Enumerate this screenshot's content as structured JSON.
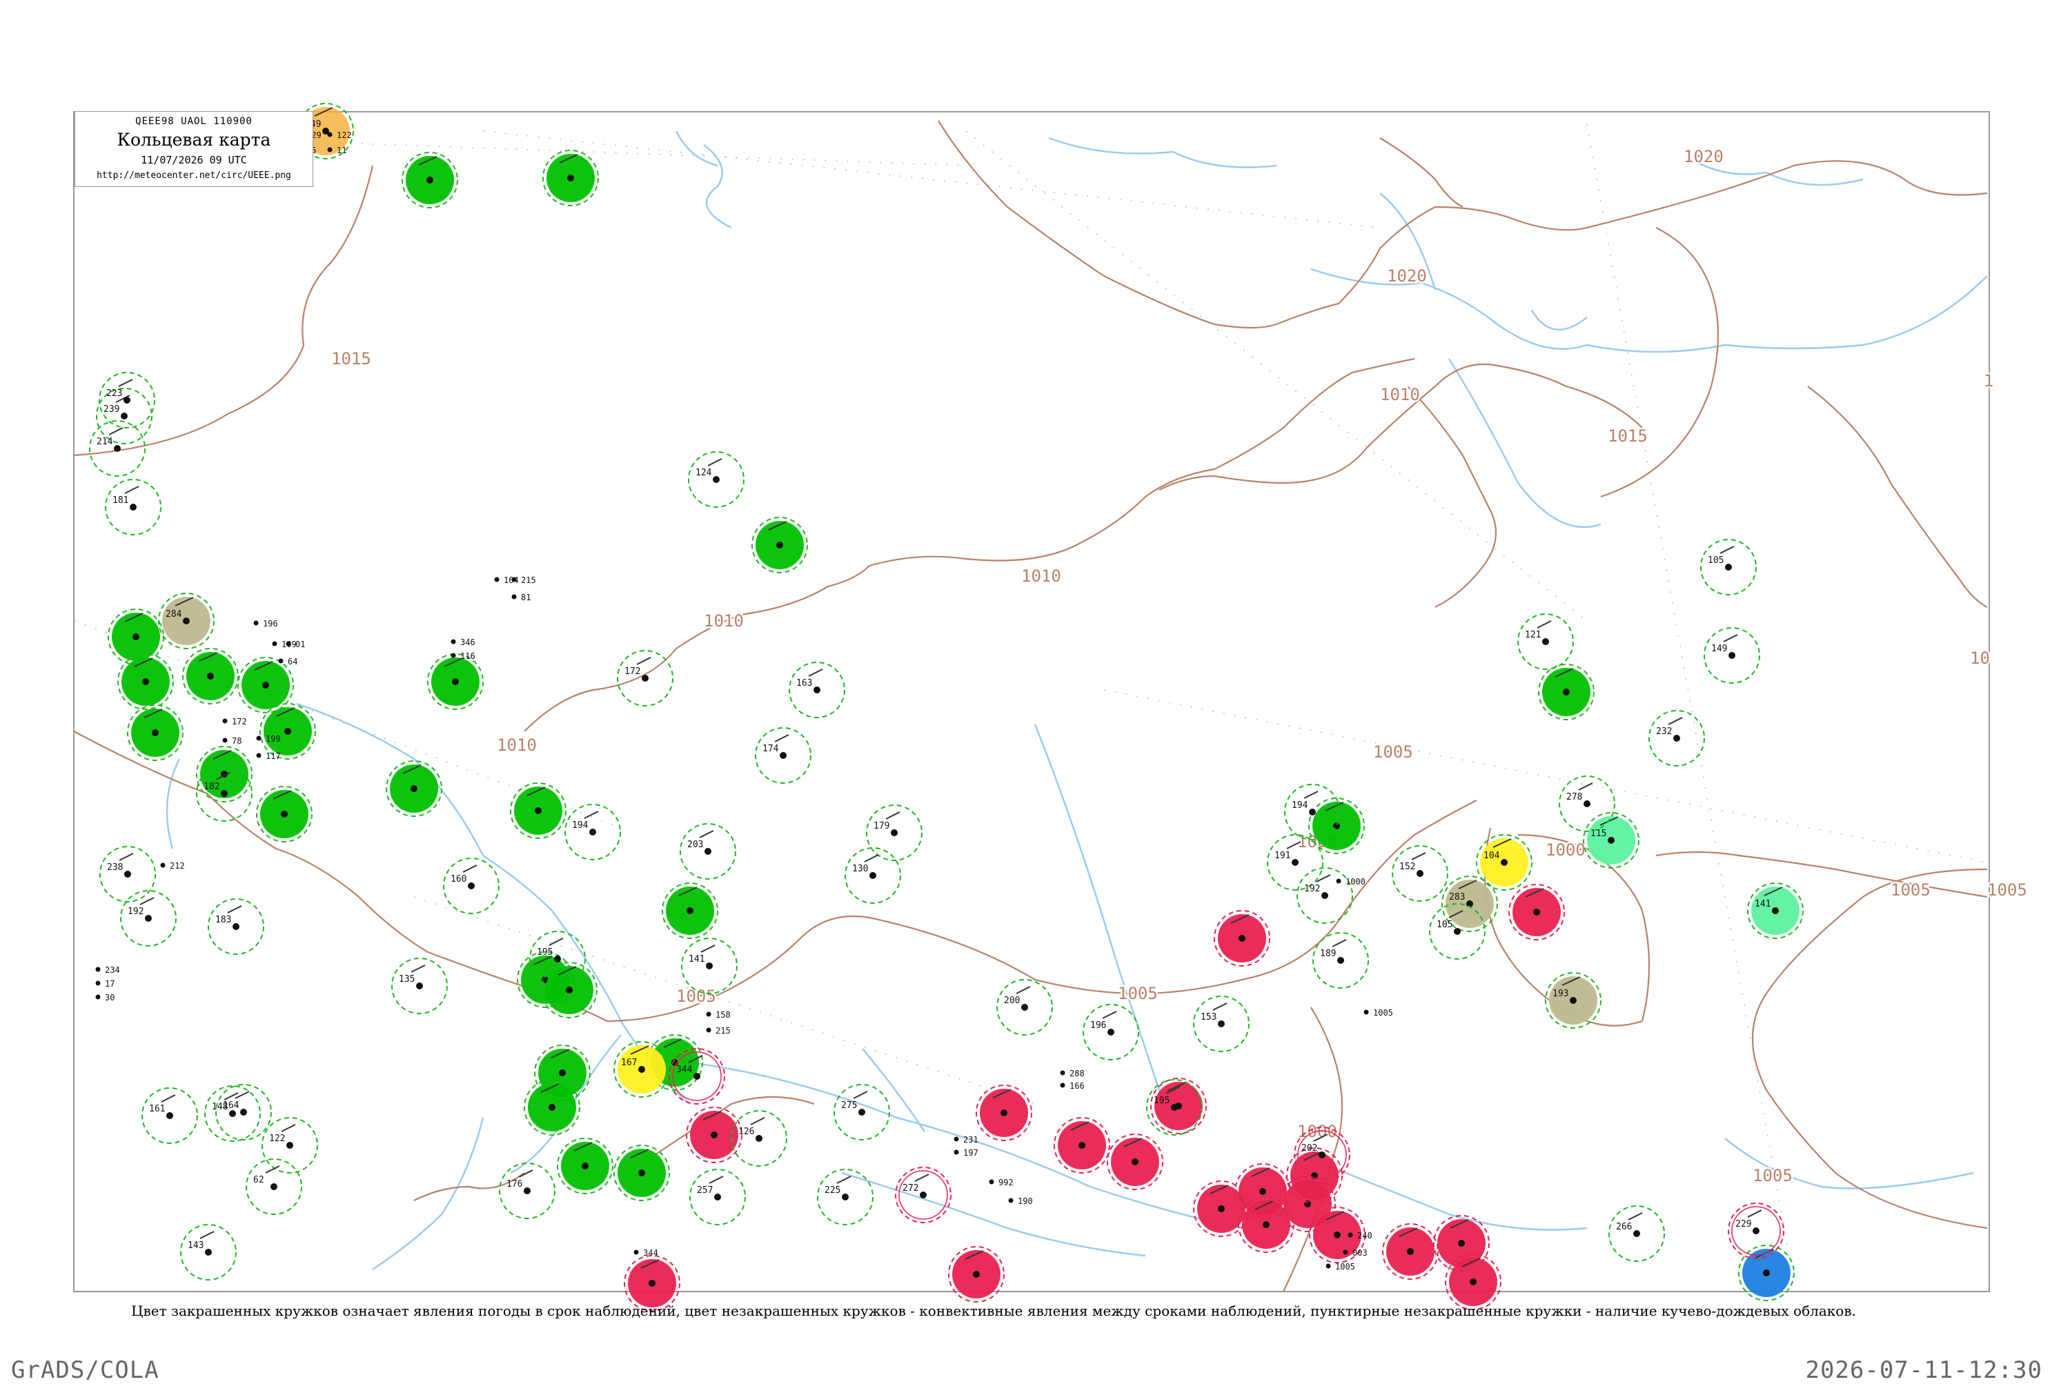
{
  "header": {
    "code": "QEEE98  UAOL  110900",
    "title": "Кольцевая карта",
    "date": "11/07/2026 09 UTC",
    "url": "http://meteocenter.net/circ/UEEE.png"
  },
  "caption": "Цвет закрашенных кружков означает явления погоды в срок наблюдений, цвет незакрашенных кружков - конвективные явления между сроками наблюдений, пунктирные незакрашенные кружки - наличие кучево-дождевых облаков.",
  "footer": {
    "software": "GrADS/COLA",
    "timestamp": "2026-07-11-12:30"
  },
  "colors": {
    "frame": "#999999",
    "isobar": "#b9826a",
    "river": "#9ccbf0",
    "green": "#00c000",
    "red": "#e8224f",
    "olive": "#bdb98f",
    "yellow": "#fff020",
    "orange": "#f7b13f",
    "blue": "#1e7fe0",
    "mint": "#5cf2a0",
    "dash": "#1fb81f",
    "dashRed": "#e8224f"
  },
  "isobar_labels": [
    "1015",
    "1010",
    "1010",
    "1010",
    "1005",
    "1005",
    "1005",
    "1000",
    "1000",
    "1005",
    "1010",
    "1015",
    "1020",
    "1020",
    "1000",
    "1005",
    "1005",
    "10",
    "1"
  ],
  "station_values": [
    "158",
    "110",
    "229",
    "75",
    "122",
    "11",
    "215",
    "81",
    "164",
    "346",
    "116",
    "158",
    "215",
    "196",
    "64",
    "109",
    "01",
    "172",
    "78",
    "199",
    "117",
    "212",
    "234",
    "17",
    "30",
    "1005",
    "1000",
    "288",
    "166",
    "231",
    "197",
    "992",
    "190",
    "344",
    "003",
    "240",
    "1005"
  ],
  "stations": [
    {
      "kind": "filled",
      "color": "orange",
      "value": "149"
    },
    {
      "kind": "filled",
      "color": "green"
    },
    {
      "kind": "filled",
      "color": "green"
    },
    {
      "kind": "filled",
      "color": "green"
    },
    {
      "kind": "filled",
      "color": "green"
    },
    {
      "kind": "filled",
      "color": "green"
    },
    {
      "kind": "filled",
      "color": "green"
    },
    {
      "kind": "filled",
      "color": "green"
    },
    {
      "kind": "filled",
      "color": "green"
    },
    {
      "kind": "filled",
      "color": "green"
    },
    {
      "kind": "filled",
      "color": "green"
    },
    {
      "kind": "filled",
      "color": "green"
    },
    {
      "kind": "filled",
      "color": "green"
    },
    {
      "kind": "filled",
      "color": "green"
    },
    {
      "kind": "filled",
      "color": "green"
    },
    {
      "kind": "filled",
      "color": "green"
    },
    {
      "kind": "filled",
      "color": "green"
    },
    {
      "kind": "filled",
      "color": "green"
    },
    {
      "kind": "filled",
      "color": "green"
    },
    {
      "kind": "filled",
      "color": "green"
    },
    {
      "kind": "filled",
      "color": "green"
    },
    {
      "kind": "filled",
      "color": "green"
    },
    {
      "kind": "filled",
      "color": "green"
    },
    {
      "kind": "filled",
      "color": "green"
    },
    {
      "kind": "filled",
      "color": "green"
    },
    {
      "kind": "filled",
      "color": "olive",
      "value": "193"
    },
    {
      "kind": "filled",
      "color": "olive",
      "value": "284"
    },
    {
      "kind": "filled",
      "color": "olive",
      "value": "283"
    },
    {
      "kind": "filled",
      "color": "yellow",
      "value": "104"
    },
    {
      "kind": "filled",
      "color": "yellow",
      "value": "167"
    },
    {
      "kind": "filled",
      "color": "blue"
    },
    {
      "kind": "filled",
      "color": "mint",
      "value": "141"
    },
    {
      "kind": "filled",
      "color": "mint",
      "value": "115"
    },
    {
      "kind": "filled",
      "color": "red"
    },
    {
      "kind": "filled",
      "color": "red"
    },
    {
      "kind": "filled",
      "color": "red"
    },
    {
      "kind": "filled",
      "color": "red"
    },
    {
      "kind": "filled",
      "color": "red"
    },
    {
      "kind": "filled",
      "color": "red"
    },
    {
      "kind": "filled",
      "color": "red"
    },
    {
      "kind": "filled",
      "color": "red"
    },
    {
      "kind": "filled",
      "color": "red"
    },
    {
      "kind": "filled",
      "color": "red"
    },
    {
      "kind": "filled",
      "color": "red"
    },
    {
      "kind": "filled",
      "color": "red"
    },
    {
      "kind": "filled",
      "color": "red"
    },
    {
      "kind": "filled",
      "color": "red"
    },
    {
      "kind": "filled",
      "color": "red"
    },
    {
      "kind": "filled",
      "color": "red"
    },
    {
      "kind": "filled",
      "color": "red"
    },
    {
      "kind": "filled",
      "color": "red"
    },
    {
      "kind": "ring",
      "value": "195"
    },
    {
      "kind": "ring",
      "value": "239"
    },
    {
      "kind": "ring",
      "value": "223"
    },
    {
      "kind": "ring",
      "value": "214"
    },
    {
      "kind": "ring",
      "value": "181"
    },
    {
      "kind": "ring",
      "value": "124"
    },
    {
      "kind": "ring",
      "value": "105"
    },
    {
      "kind": "ring",
      "value": "121"
    },
    {
      "kind": "ring",
      "value": "149"
    },
    {
      "kind": "ring",
      "value": "163"
    },
    {
      "kind": "ring",
      "value": "172"
    },
    {
      "kind": "ring",
      "value": "174"
    },
    {
      "kind": "ring",
      "value": "179"
    },
    {
      "kind": "ring",
      "value": "130"
    },
    {
      "kind": "ring",
      "value": "200"
    },
    {
      "kind": "ring",
      "value": "238"
    },
    {
      "kind": "ring",
      "value": "192"
    },
    {
      "kind": "ring",
      "value": "183"
    },
    {
      "kind": "ring",
      "value": "182"
    },
    {
      "kind": "ring",
      "value": "194"
    },
    {
      "kind": "ring",
      "value": "203"
    },
    {
      "kind": "ring",
      "value": "160"
    },
    {
      "kind": "ring",
      "value": "195"
    },
    {
      "kind": "ring",
      "value": "135"
    },
    {
      "kind": "ring",
      "value": "141"
    },
    {
      "kind": "ring",
      "value": "164"
    },
    {
      "kind": "ring",
      "value": "161"
    },
    {
      "kind": "ring",
      "value": "148"
    },
    {
      "kind": "ring",
      "value": "122"
    },
    {
      "kind": "ring",
      "value": "62"
    },
    {
      "kind": "ring",
      "value": "143"
    },
    {
      "kind": "ring",
      "value": "176"
    },
    {
      "kind": "ring",
      "value": "196"
    },
    {
      "kind": "ring",
      "value": "153"
    },
    {
      "kind": "ring",
      "value": "191"
    },
    {
      "kind": "ring",
      "value": "189"
    },
    {
      "kind": "ring",
      "value": "192"
    },
    {
      "kind": "ring",
      "value": "152"
    },
    {
      "kind": "ring",
      "value": "105"
    },
    {
      "kind": "ring",
      "value": "194"
    },
    {
      "kind": "ring",
      "value": "232"
    },
    {
      "kind": "ring",
      "value": "278"
    },
    {
      "kind": "ring",
      "value": "266"
    },
    {
      "kind": "ring",
      "value": "275"
    },
    {
      "kind": "ring",
      "value": "225"
    },
    {
      "kind": "ring",
      "value": "257"
    },
    {
      "kind": "ring",
      "value": "126"
    },
    {
      "kind": "ringRed",
      "value": "344"
    },
    {
      "kind": "ringRed",
      "value": "202"
    },
    {
      "kind": "ringRed",
      "value": "229"
    },
    {
      "kind": "ringRed",
      "value": "272"
    }
  ]
}
